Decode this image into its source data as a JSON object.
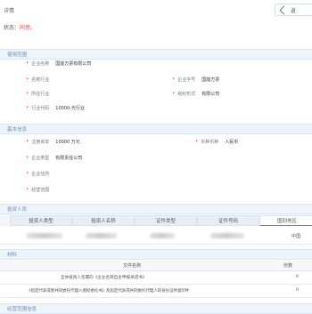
{
  "header": {
    "title": "详情",
    "nav_button": "返"
  },
  "status": {
    "label": "状态：",
    "value": "同意。"
  },
  "sections": {
    "usage": "使用范围",
    "basic": "基本信息",
    "investor": "投资人员",
    "files": "材料",
    "bottom": "经营范围信息"
  },
  "usage_fields": [
    {
      "label": "企业名称",
      "value": "国能方票有限公司"
    },
    {
      "label": "名称行业",
      "value": ""
    },
    {
      "label": "企业字号",
      "value": "国能方票"
    },
    {
      "label": "所在行业",
      "value": ""
    },
    {
      "label": "组织形式",
      "value": "有限公司"
    },
    {
      "label": "行业代码",
      "value": "10000-光行业"
    }
  ],
  "basic_fields": [
    {
      "label": "注册资本",
      "value": "10000 万元"
    },
    {
      "label": "币种币种",
      "value": "人民币"
    },
    {
      "label": "企业类型",
      "value": "有限责任公司"
    },
    {
      "label": "企业住所",
      "value": ""
    },
    {
      "label": "经营范围",
      "value": ""
    }
  ],
  "investor_table": {
    "headers": [
      "投资人类型",
      "投资人名称",
      "证件类型",
      "证件号码",
      "国别地区"
    ],
    "active_index": 4,
    "country": "中国"
  },
  "file_table": {
    "headers": [
      "文件名称",
      "份数"
    ],
    "rows": [
      {
        "name": "全体投资人签署的《企业名称自主申报承诺书》",
        "count": "0"
      },
      {
        "name": "《指定代表或者共同委托代理人授权委托书》及指定代表或共同委托代理人的身份证件复印件",
        "count": "0"
      }
    ]
  }
}
